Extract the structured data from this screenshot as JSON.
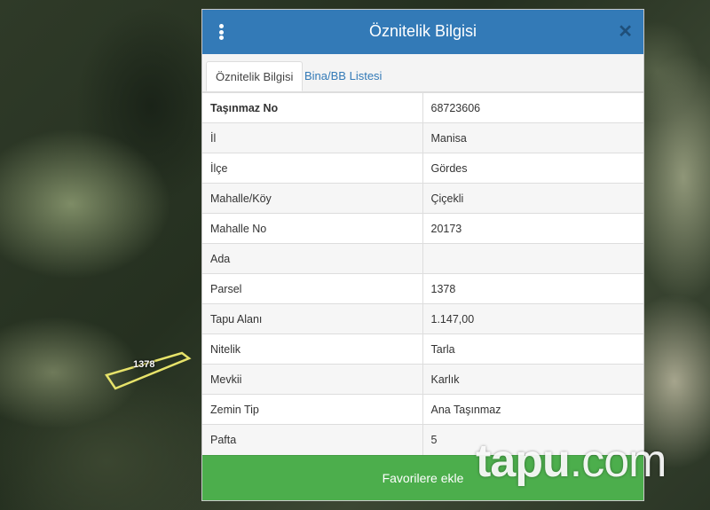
{
  "map": {
    "parcel_label": "1378"
  },
  "modal": {
    "title": "Öznitelik Bilgisi",
    "tabs": [
      {
        "label": "Öznitelik Bilgisi",
        "active": true
      },
      {
        "label": "Bina/BB Listesi",
        "active": false
      }
    ],
    "rows": [
      {
        "key": "Taşınmaz No",
        "value": "68723606"
      },
      {
        "key": "İl",
        "value": "Manisa"
      },
      {
        "key": "İlçe",
        "value": "Gördes"
      },
      {
        "key": "Mahalle/Köy",
        "value": "Çiçekli"
      },
      {
        "key": "Mahalle No",
        "value": "20173"
      },
      {
        "key": "Ada",
        "value": ""
      },
      {
        "key": "Parsel",
        "value": "1378"
      },
      {
        "key": "Tapu Alanı",
        "value": "1.147,00"
      },
      {
        "key": "Nitelik",
        "value": "Tarla"
      },
      {
        "key": "Mevkii",
        "value": "Karlık"
      },
      {
        "key": "Zemin Tip",
        "value": "Ana Taşınmaz"
      },
      {
        "key": "Pafta",
        "value": "5"
      }
    ],
    "favorite_button": "Favorilere ekle",
    "icons": {
      "menu": "kebab-menu-icon",
      "close": "close-icon"
    }
  },
  "watermark": {
    "part1": "tapu",
    "part2": ".com"
  },
  "colors": {
    "header": "#337ab7",
    "button": "#4cae4c"
  }
}
